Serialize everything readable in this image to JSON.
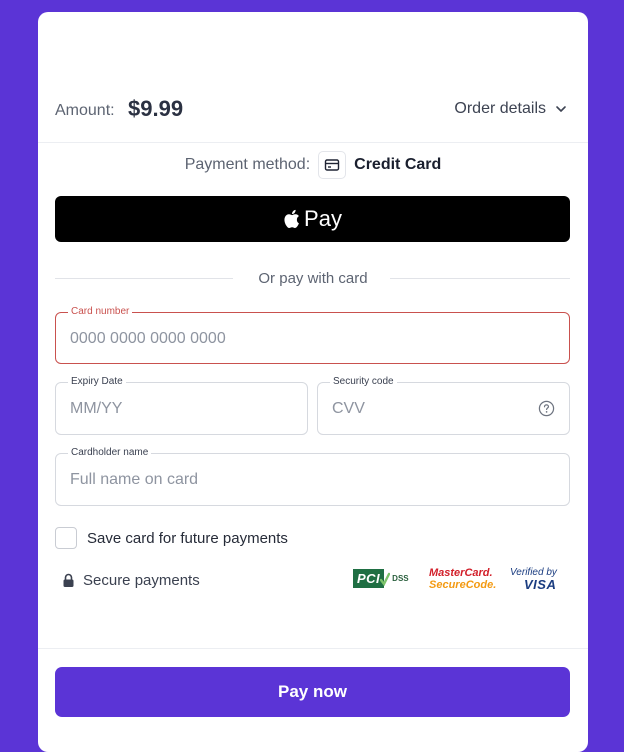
{
  "amount": {
    "label": "Amount:",
    "value": "$9.99"
  },
  "order_details": {
    "label": "Order details",
    "icon": "chevron-down-icon"
  },
  "payment_method": {
    "label": "Payment method:",
    "value": "Credit Card",
    "icon": "credit-card-icon"
  },
  "apple_pay": {
    "label": "Pay",
    "icon": "apple-icon"
  },
  "separator": {
    "text": "Or pay with card"
  },
  "card_number": {
    "label": "Card number",
    "placeholder": "0000 0000 0000 0000"
  },
  "expiry": {
    "label": "Expiry Date",
    "placeholder": "MM/YY"
  },
  "security_code": {
    "label": "Security code",
    "placeholder": "CVV",
    "icon": "help-circle-icon"
  },
  "cardholder": {
    "label": "Cardholder name",
    "placeholder": "Full name on card"
  },
  "save_card": {
    "label": "Save card for future payments",
    "checked": false
  },
  "secure": {
    "label": "Secure payments",
    "icon": "lock-icon"
  },
  "badges": {
    "pci": {
      "main": "PCI",
      "sub": "DSS"
    },
    "mastercard": {
      "line1": "MasterCard.",
      "line2": "SecureCode."
    },
    "visa": {
      "line1": "Verified by",
      "line2": "VISA"
    }
  },
  "pay_button": {
    "label": "Pay now"
  },
  "colors": {
    "accent": "#5b34d6",
    "error": "#c9514e",
    "apple_pay_bg": "#000000"
  }
}
